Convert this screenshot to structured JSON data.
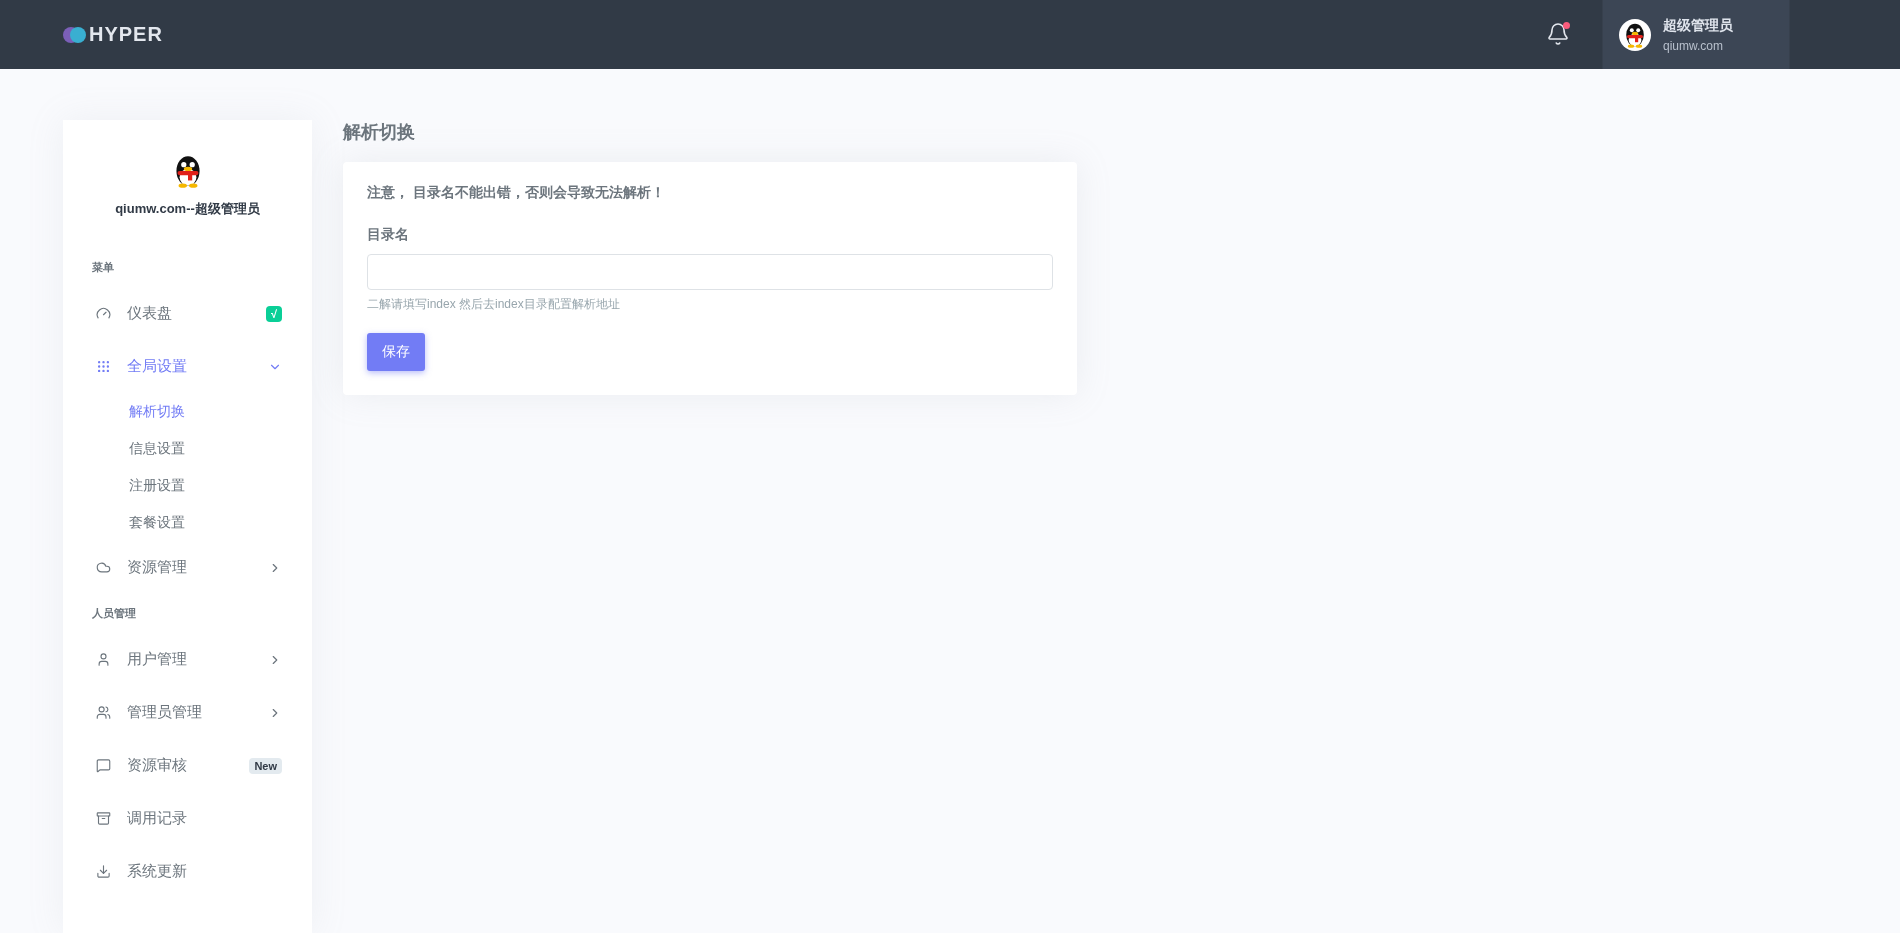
{
  "topbar": {
    "logo": "HYPER",
    "notification_dot": true,
    "user": {
      "name": "超级管理员",
      "subtitle": "qiumw.com"
    }
  },
  "sidebar": {
    "profile_name": "qiumw.com--超级管理员",
    "sections": [
      {
        "title": "菜单",
        "items": [
          {
            "label": "仪表盘",
            "kind": "link",
            "badge": {
              "text": "√",
              "kind": "success"
            }
          },
          {
            "label": "全局设置",
            "kind": "group",
            "expanded": true,
            "selected": true,
            "children": [
              {
                "label": "解析切换",
                "selected": true
              },
              {
                "label": "信息设置",
                "selected": false
              },
              {
                "label": "注册设置",
                "selected": false
              },
              {
                "label": "套餐设置",
                "selected": false
              }
            ]
          },
          {
            "label": "资源管理",
            "kind": "group",
            "expanded": false,
            "selected": false
          }
        ]
      },
      {
        "title": "人员管理",
        "items": [
          {
            "label": "用户管理",
            "kind": "group",
            "expanded": false,
            "selected": false
          },
          {
            "label": "管理员管理",
            "kind": "group",
            "expanded": false,
            "selected": false
          },
          {
            "label": "资源审核",
            "kind": "link",
            "badge": {
              "text": "New",
              "kind": "light"
            }
          },
          {
            "label": "调用记录",
            "kind": "link"
          },
          {
            "label": "系统更新",
            "kind": "link"
          }
        ]
      }
    ]
  },
  "page": {
    "title": "解析切换",
    "notice": "注意， 目录名不能出错，否则会导致无法解析！",
    "field": {
      "label": "目录名",
      "help": "二解请填写index 然后去index目录配置解析地址"
    },
    "button": "保存"
  }
}
